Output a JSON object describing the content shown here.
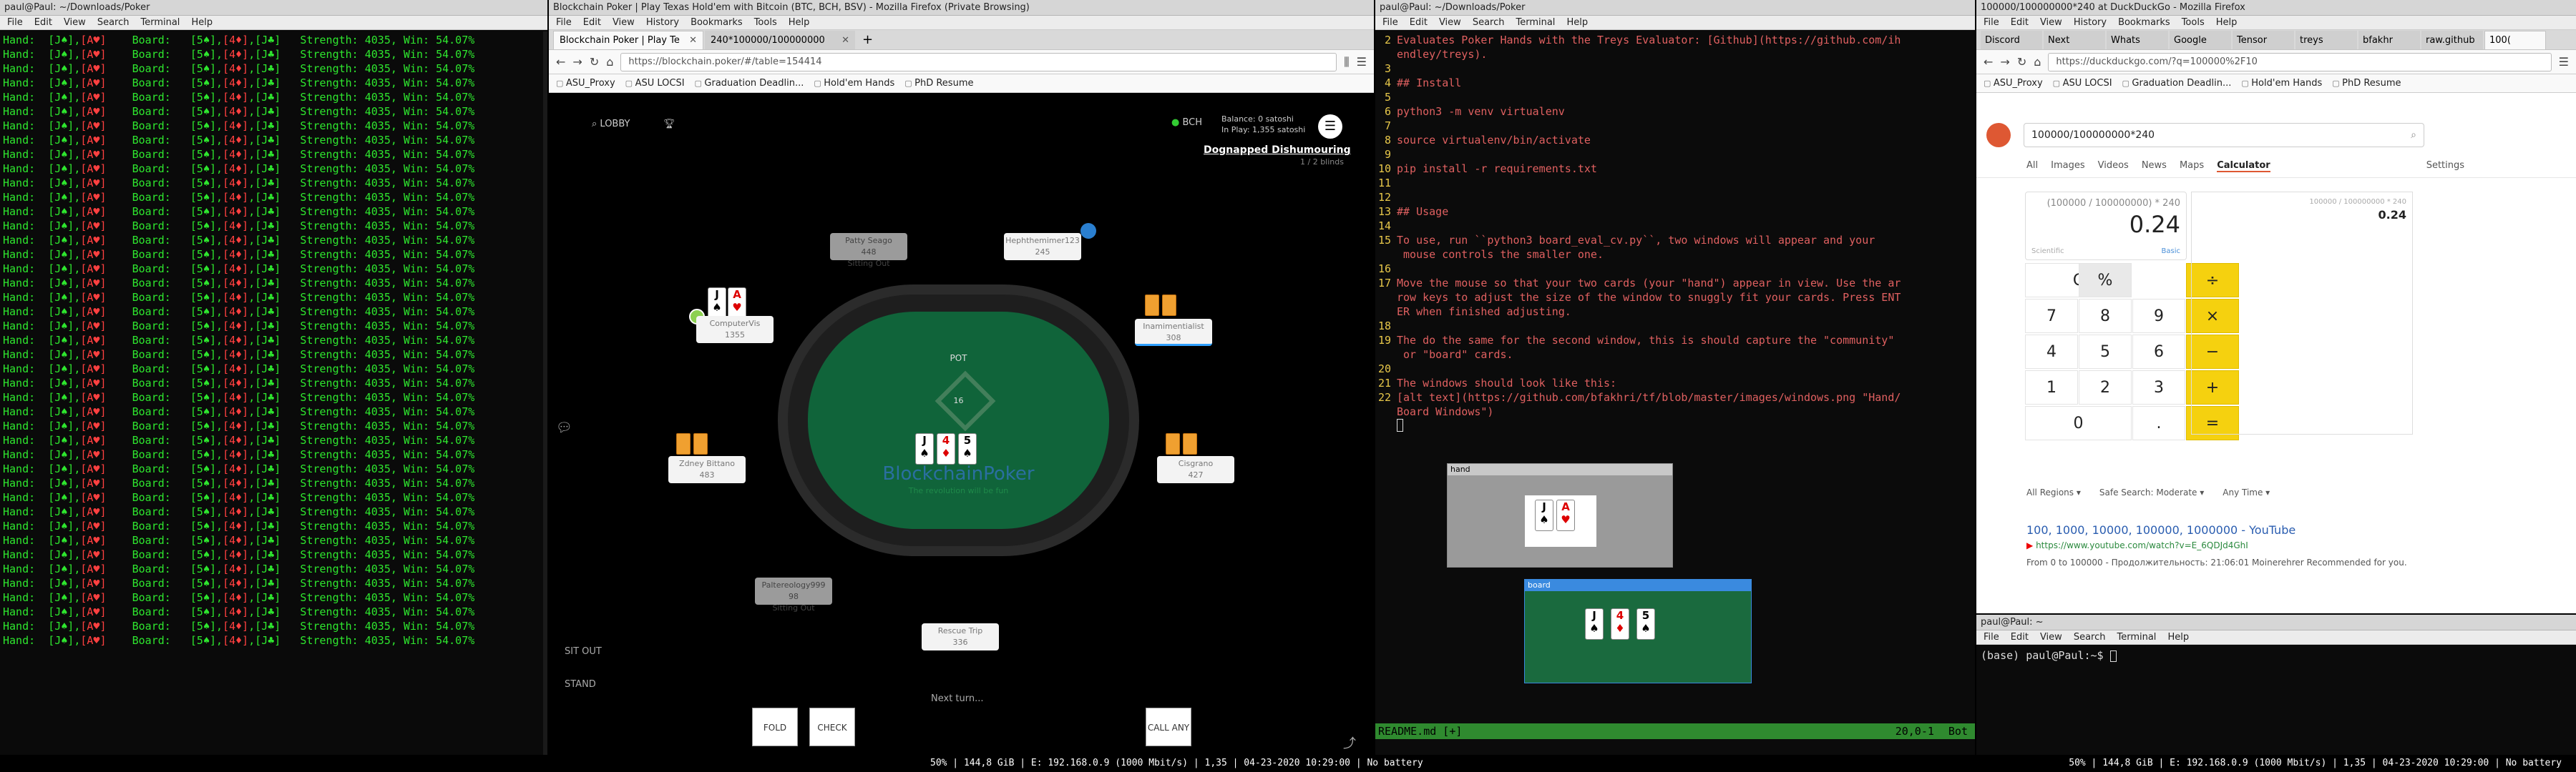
{
  "term1": {
    "title": "paul@Paul: ~/Downloads/Poker",
    "menu": [
      "File",
      "Edit",
      "View",
      "Search",
      "Terminal",
      "Help"
    ],
    "line": {
      "hand_label": "Hand:",
      "hand": "[J♠],[A♥]",
      "board_label": "Board:",
      "board": "[5♠],[4♦],[J♣]",
      "result": "Strength: 4035, Win: 54.07%"
    },
    "rows": 43
  },
  "ff1": {
    "title": "Blockchain Poker | Play Texas Hold'em with Bitcoin (BTC, BCH, BSV) - Mozilla Firefox (Private Browsing)",
    "menu": [
      "File",
      "Edit",
      "View",
      "History",
      "Bookmarks",
      "Tools",
      "Help"
    ],
    "tabs": [
      "Blockchain Poker | Play Te",
      "240*100000/100000000"
    ],
    "url": "https://blockchain.poker/#/table=154414",
    "bookmarks": [
      "ASU_Proxy",
      "ASU LOCSI",
      "Graduation Deadlin...",
      "Hold'em Hands",
      "PhD Resume"
    ],
    "game": {
      "lobby": "LOBBY",
      "balance": "Balance: 0 satoshi",
      "inplay": "In Play: 1,355 satoshi",
      "currency": "BCH",
      "table_name": "Dognapped Dishumouring",
      "blinds": "1 / 2 blinds",
      "pot_label": "POT",
      "pot_value": "16",
      "brand": "BlockchainPoker",
      "tagline": "The revolution will be fun",
      "sit_out": "SIT OUT",
      "stand": "STAND",
      "next_turn": "Next turn...",
      "fold": "FOLD",
      "check": "CHECK",
      "callany": "CALL ANY",
      "seats": [
        {
          "name": "Patty Seago",
          "chips": "448",
          "state": "Sitting Out"
        },
        {
          "name": "Hephthemimer123",
          "chips": "245",
          "state": ""
        },
        {
          "name": "ComputerVis",
          "chips": "1355",
          "state": ""
        },
        {
          "name": "Inamimentialist",
          "chips": "308",
          "state": ""
        },
        {
          "name": "Zdney Bittano",
          "chips": "483",
          "state": ""
        },
        {
          "name": "Cisgrano",
          "chips": "427",
          "state": ""
        },
        {
          "name": "Paltereology999",
          "chips": "98",
          "state": "Sitting Out"
        },
        {
          "name": "Rescue Trip",
          "chips": "336",
          "state": ""
        }
      ],
      "hero_cards": [
        {
          "rank": "J",
          "suit": "♠",
          "red": false
        },
        {
          "rank": "A",
          "suit": "♥",
          "red": true
        }
      ],
      "board_cards": [
        {
          "rank": "J",
          "suit": "♠",
          "red": false
        },
        {
          "rank": "4",
          "suit": "♦",
          "red": true
        },
        {
          "rank": "5",
          "suit": "♠",
          "red": false
        }
      ]
    }
  },
  "vim": {
    "title": "paul@Paul: ~/Downloads/Poker",
    "menu": [
      "File",
      "Edit",
      "View",
      "Search",
      "Terminal",
      "Help"
    ],
    "lines": [
      {
        "n": "2",
        "t": "Evaluates Poker Hands with the Treys Evaluator: [Github](https://github.com/ih",
        "c": ""
      },
      {
        "n": "",
        "t": "endley/treys).",
        "c": ""
      },
      {
        "n": "3",
        "t": "",
        "c": ""
      },
      {
        "n": "4",
        "t": "## Install",
        "c": "h"
      },
      {
        "n": "5",
        "t": "",
        "c": ""
      },
      {
        "n": "6",
        "t": "python3 -m venv virtualenv",
        "c": ""
      },
      {
        "n": "7",
        "t": "",
        "c": ""
      },
      {
        "n": "8",
        "t": "source virtualenv/bin/activate",
        "c": ""
      },
      {
        "n": "9",
        "t": "",
        "c": ""
      },
      {
        "n": "10",
        "t": "pip install -r requirements.txt",
        "c": ""
      },
      {
        "n": "11",
        "t": "",
        "c": ""
      },
      {
        "n": "12",
        "t": "",
        "c": ""
      },
      {
        "n": "13",
        "t": "## Usage",
        "c": "h"
      },
      {
        "n": "14",
        "t": "",
        "c": ""
      },
      {
        "n": "15",
        "t": "To use, run ``python3 board_eval_cv.py``, two windows will appear and your",
        "c": ""
      },
      {
        "n": "",
        "t": " mouse controls the smaller one.",
        "c": ""
      },
      {
        "n": "16",
        "t": "",
        "c": ""
      },
      {
        "n": "17",
        "t": "Move the mouse so that your two cards (your \"hand\") appear in view. Use the ar",
        "c": ""
      },
      {
        "n": "",
        "t": "row keys to adjust the size of the window to snuggly fit your cards. Press ENT",
        "c": ""
      },
      {
        "n": "",
        "t": "ER when finished adjusting.",
        "c": ""
      },
      {
        "n": "18",
        "t": "",
        "c": ""
      },
      {
        "n": "19",
        "t": "The do the same for the second window, this is should capture the \"community\"",
        "c": ""
      },
      {
        "n": "",
        "t": " or \"board\" cards.",
        "c": ""
      },
      {
        "n": "20",
        "t": "",
        "c": ""
      },
      {
        "n": "21",
        "t": "The windows should look like this:",
        "c": ""
      },
      {
        "n": "22",
        "t": "[alt text](https://github.com/bfakhri/tf/blob/master/images/windows.png \"Hand/",
        "c": ""
      },
      {
        "n": "",
        "t": "Board Windows\")",
        "c": ""
      }
    ],
    "status_file": "README.md [+]",
    "status_pos": "20,0-1",
    "status_pct": "Bot",
    "hand_window": "hand",
    "board_window": "board"
  },
  "ff2": {
    "title": "100000/100000000*240 at DuckDuckGo - Mozilla Firefox",
    "menu": [
      "File",
      "Edit",
      "View",
      "History",
      "Bookmarks",
      "Tools",
      "Help"
    ],
    "tabs": [
      "Discord",
      "Next",
      "Whats",
      "Google",
      "Tensor",
      "treys",
      "bfakhr",
      "raw.github",
      "100("
    ],
    "url": "https://duckduckgo.com/?q=100000%2F10",
    "bookmarks": [
      "ASU_Proxy",
      "ASU LOCSI",
      "Graduation Deadlin...",
      "Hold'em Hands",
      "PhD Resume"
    ],
    "search": "100000/100000000*240",
    "nav": [
      "All",
      "Images",
      "Videos",
      "News",
      "Maps",
      "Calculator",
      "Settings"
    ],
    "expr": "(100000 / 100000000) * 240",
    "result": "0.24",
    "mode_sci": "Scientific",
    "mode_basic": "Basic",
    "side_expr": "100000 / 100000000 * 240",
    "side_result": "0.24",
    "keys": [
      "C",
      "%",
      "÷",
      "7",
      "8",
      "9",
      "×",
      "4",
      "5",
      "6",
      "−",
      "1",
      "2",
      "3",
      "+",
      "0",
      ".",
      "="
    ],
    "filters": [
      "All Regions",
      "Safe Search: Moderate",
      "Any Time"
    ],
    "result_title": "100, 1000, 10000, 100000, 1000000 - YouTube",
    "result_url": "https://www.youtube.com/watch?v=E_6QDJd4GhI",
    "result_snip": "From 0 to 100000 - Продолжительность: 21:06:01 Moinerehrer Recommended for you."
  },
  "term2": {
    "title": "paul@Paul: ~",
    "menu": [
      "File",
      "Edit",
      "View",
      "Search",
      "Terminal",
      "Help"
    ],
    "prompt": "(base) paul@Paul:~$"
  },
  "statusbar": {
    "left": "50% | 144,8 GiB | E: 192.168.0.9 (1000 Mbit/s) | 1,35 | 04-23-2020 10:29:00 | No battery",
    "right": "50% | 144,8 GiB | E: 192.168.0.9 (1000 Mbit/s) | 1,35 | 04-23-2020 10:29:00 | No battery"
  },
  "colors": {
    "term_green": "#2ee62e",
    "poker_felt": "#10643a",
    "ddg_yellow": "#f5d10f",
    "vim_status": "#2f8a2f"
  }
}
